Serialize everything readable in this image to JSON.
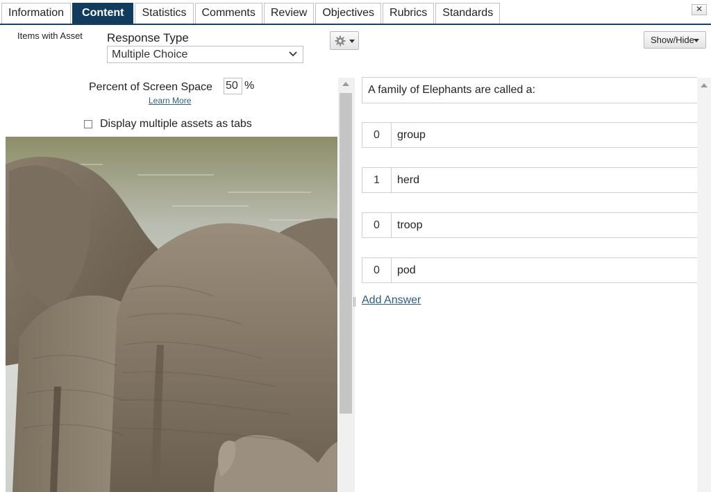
{
  "tabs": [
    {
      "label": "Information",
      "active": false
    },
    {
      "label": "Content",
      "active": true
    },
    {
      "label": "Statistics",
      "active": false
    },
    {
      "label": "Comments",
      "active": false
    },
    {
      "label": "Review",
      "active": false
    },
    {
      "label": "Objectives",
      "active": false
    },
    {
      "label": "Rubrics",
      "active": false
    },
    {
      "label": "Standards",
      "active": false
    }
  ],
  "close_label": "✕",
  "left_panel": {
    "items_with_asset": "Items with Asset",
    "response_type_label": "Response Type",
    "response_type_value": "Multiple Choice",
    "percent_label": "Percent of Screen Space",
    "percent_value": "50",
    "percent_unit": "%",
    "learn_more": "Learn More",
    "tabs_checkbox_label": "Display multiple assets as tabs",
    "tabs_checkbox_checked": false,
    "asset_icon": "elephant-photo"
  },
  "toolbar": {
    "gear_icon": "gear-icon",
    "showhide_label": "Show/Hide"
  },
  "question": {
    "text": "A family of Elephants are called a:",
    "answers": [
      {
        "score": "0",
        "text": "group"
      },
      {
        "score": "1",
        "text": "herd"
      },
      {
        "score": "0",
        "text": "troop"
      },
      {
        "score": "0",
        "text": "pod"
      }
    ],
    "add_answer_label": "Add Answer"
  },
  "colors": {
    "active_tab": "#123c5e",
    "link": "#2a5d85"
  }
}
